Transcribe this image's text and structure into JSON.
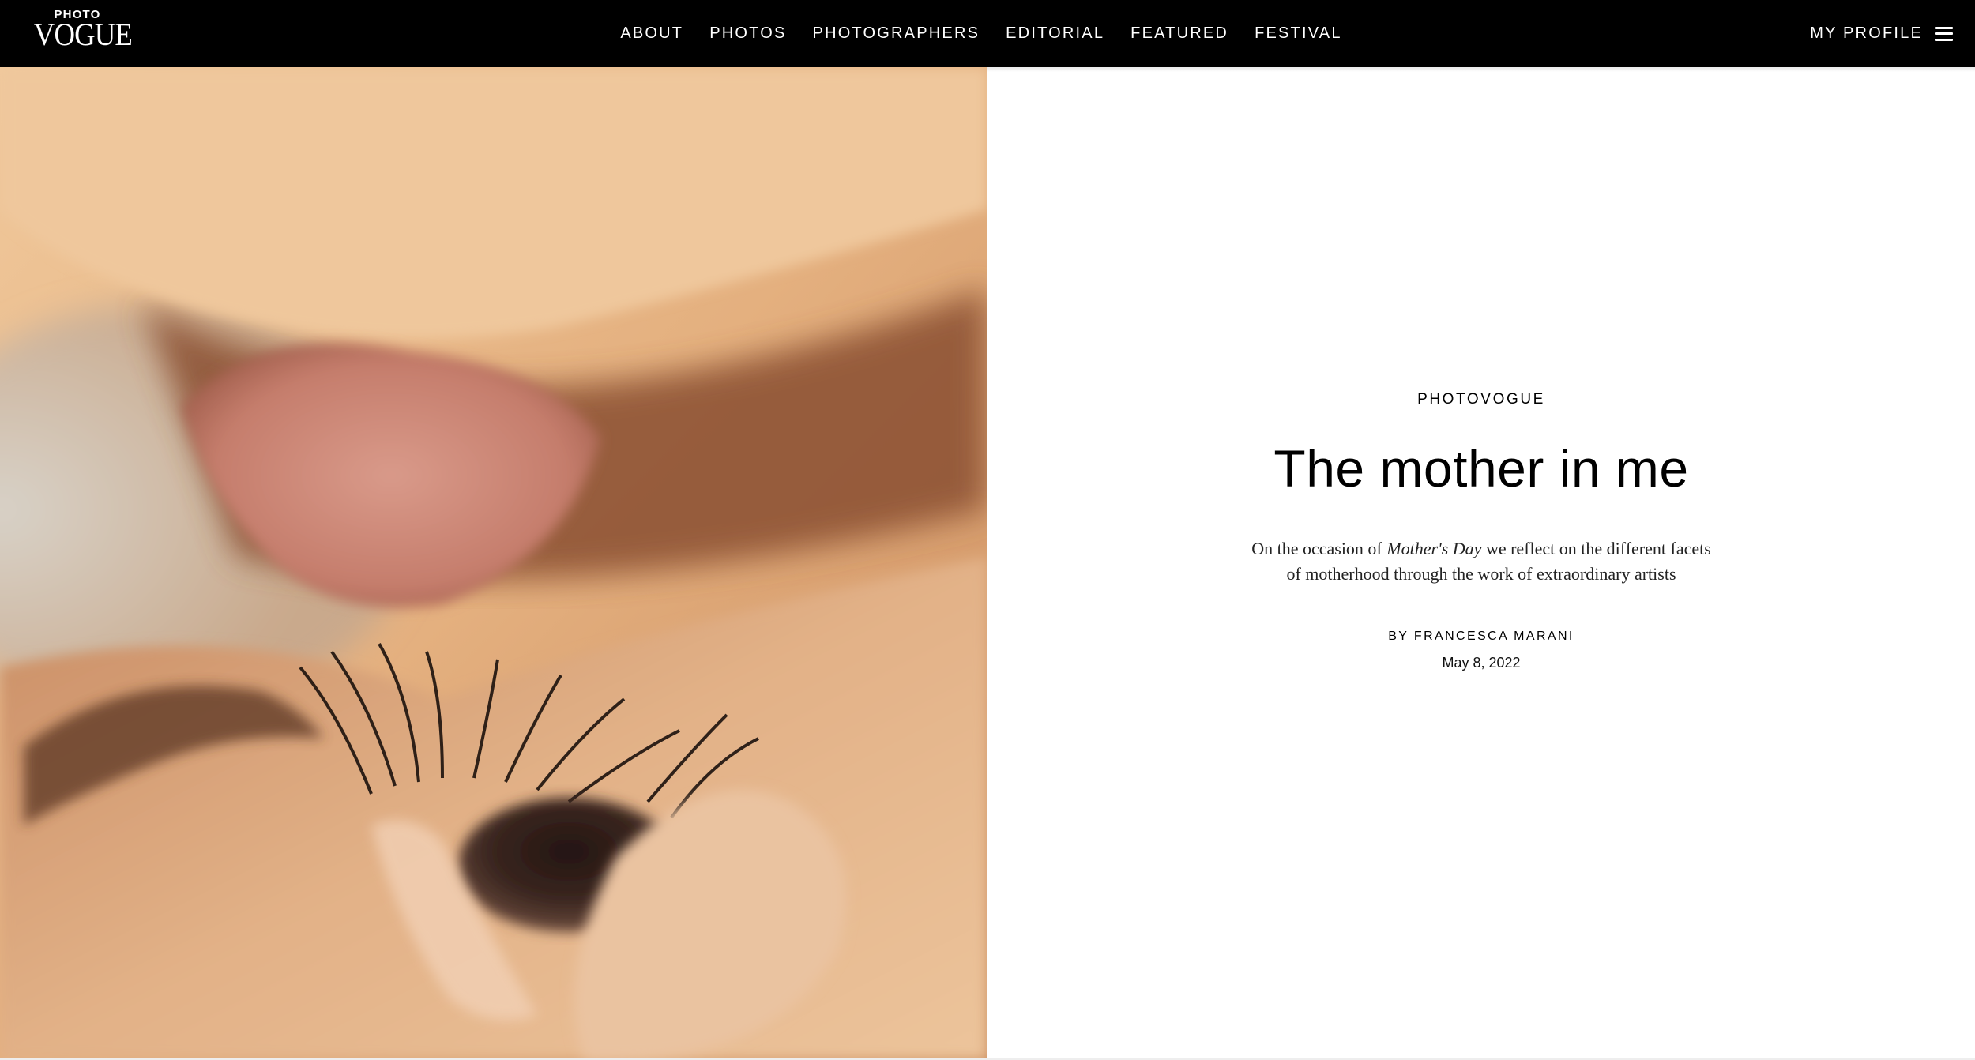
{
  "logo": {
    "top": "PHOTO",
    "main": "VOGUE"
  },
  "nav": {
    "items": [
      {
        "label": "ABOUT"
      },
      {
        "label": "PHOTOS"
      },
      {
        "label": "PHOTOGRAPHERS"
      },
      {
        "label": "EDITORIAL"
      },
      {
        "label": "FEATURED"
      },
      {
        "label": "FESTIVAL"
      }
    ],
    "profile_label": "MY PROFILE"
  },
  "hero": {
    "kicker": "PHOTOVOGUE",
    "title": "The mother in me",
    "dek_before": "On the occasion of ",
    "dek_emphasis": "Mother's Day",
    "dek_after": " we reflect on the different facets of motherhood through the work of extraordinary artists",
    "byline": "BY FRANCESCA MARANI",
    "date": "May 8, 2022"
  },
  "colors": {
    "nav_bg": "#000000",
    "nav_text": "#ffffff",
    "page_bg": "#ffffff",
    "text": "#000000"
  },
  "icons": {
    "menu": "hamburger-menu-icon"
  }
}
